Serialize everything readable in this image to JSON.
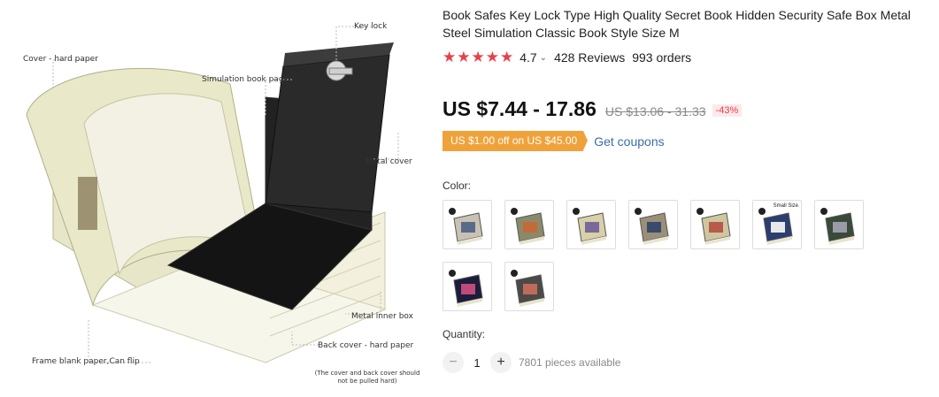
{
  "gallery": {
    "callouts": {
      "key_lock": "Key lock",
      "cover": "Cover - hard paper",
      "simulation_page": "Simulation book page",
      "metal_cover": "Metal cover",
      "metal_inner_box": "Metal inner box",
      "back_cover": "Back cover - hard paper",
      "frame_paper": "Frame blank paper,Can flip",
      "note": "(The cover and back cover should not be pulled hard)"
    }
  },
  "product": {
    "title": "Book Safes Key Lock Type High Quality Secret Book Hidden Security Safe Box Metal Steel Simulation Classic Book Style Size M",
    "stars_glyph": "★★★★★",
    "rating": "4.7",
    "rating_chevron": "⌄",
    "reviews": "428 Reviews",
    "orders": "993 orders",
    "price": "US $7.44 - 17.86",
    "old_price": "US $13.06 - 31.33",
    "discount": "-43%",
    "coupon": "US $1.00 off on US $45.00",
    "get_coupons": "Get coupons",
    "color_label": "Color:",
    "quantity_label": "Quantity:",
    "quantity_value": "1",
    "minus": "−",
    "plus": "+",
    "available": "7801 pieces available",
    "swatches": [
      {
        "cover": "#c9c2b4",
        "accent": "#5a6a8a"
      },
      {
        "cover": "#8a8a6a",
        "accent": "#c26b3a"
      },
      {
        "cover": "#d8d0a8",
        "accent": "#7a6a9a"
      },
      {
        "cover": "#9a9078",
        "accent": "#3a4a6a"
      },
      {
        "cover": "#cfc6a0",
        "accent": "#b85a4a"
      },
      {
        "cover": "#2c3e70",
        "accent": "#e8e8e8",
        "label": "Small Size"
      },
      {
        "cover": "#3a4a3a",
        "accent": "#9a9aa8"
      },
      {
        "cover": "#1c1c3c",
        "accent": "#c04a7a"
      },
      {
        "cover": "#4a4a48",
        "accent": "#c06a5a"
      }
    ]
  },
  "colors": {
    "accent": "#e8404a",
    "coupon": "#f0a23a",
    "link": "#3a6ea5"
  }
}
